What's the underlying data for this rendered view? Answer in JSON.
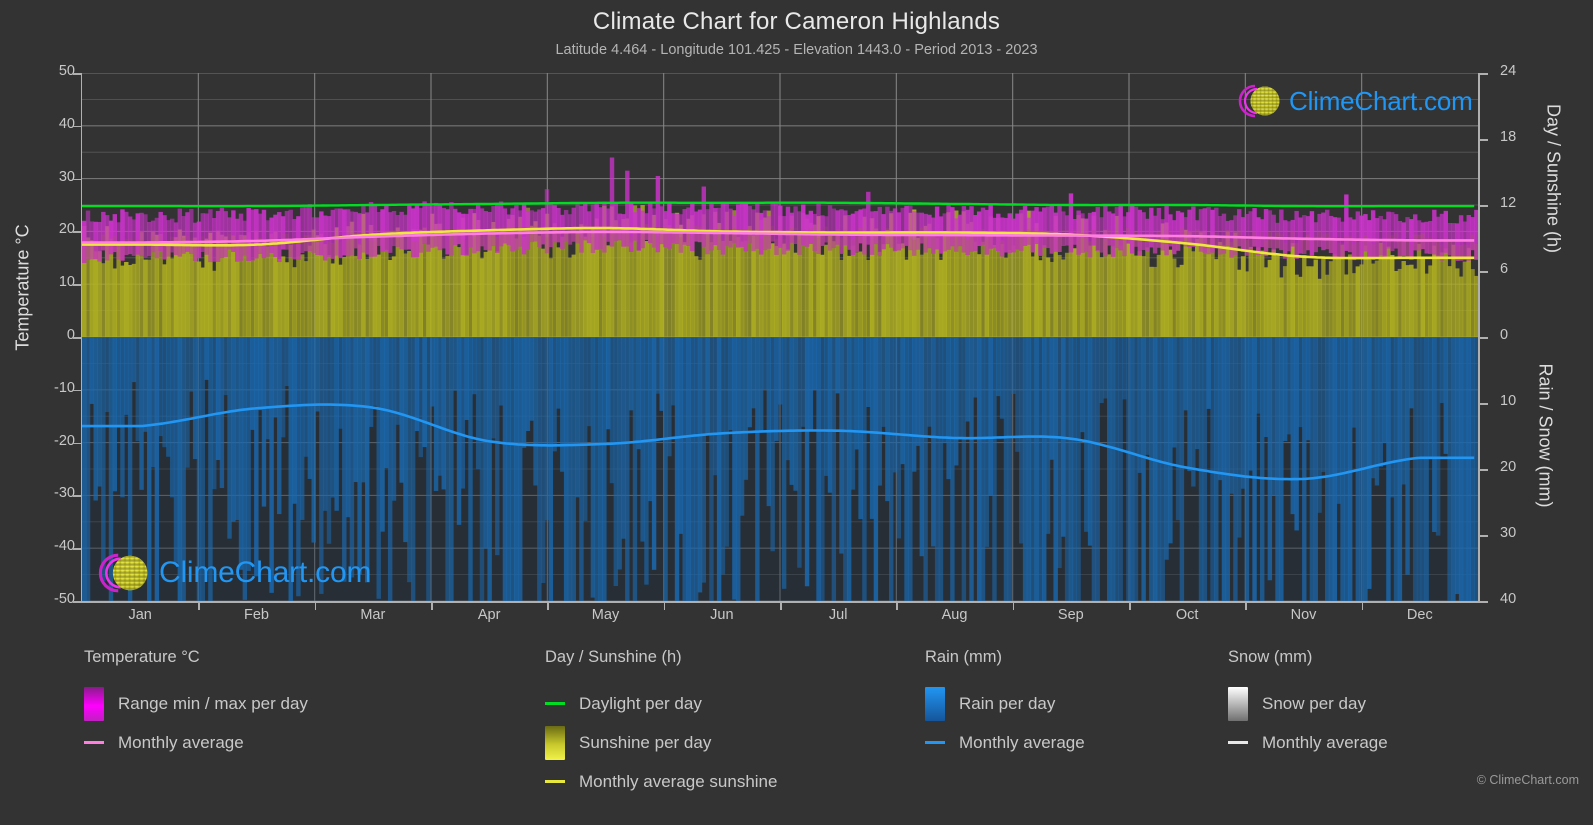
{
  "header": {
    "title": "Climate Chart for Cameron Highlands",
    "subtitle": "Latitude 4.464 - Longitude 101.425 - Elevation 1443.0 - Period 2013 - 2023"
  },
  "branding": {
    "logo_text": "ClimeChart.com",
    "copyright": "© ClimeChart.com"
  },
  "axes": {
    "left_label": "Temperature °C",
    "right_label_top": "Day / Sunshine (h)",
    "right_label_bottom": "Rain / Snow (mm)",
    "left_ticks": [
      "50",
      "40",
      "30",
      "20",
      "10",
      "0",
      "-10",
      "-20",
      "-30",
      "-40",
      "-50"
    ],
    "right_ticks_top": [
      "24",
      "18",
      "12",
      "6",
      "0"
    ],
    "right_ticks_bottom": [
      "10",
      "20",
      "30",
      "40"
    ]
  },
  "legend": {
    "groups": [
      {
        "title": "Temperature °C",
        "items": [
          {
            "label": "Range min / max per day",
            "style": "swatch",
            "color": "#ff00ff"
          },
          {
            "label": "Monthly average",
            "style": "line",
            "color": "#ff7fe0"
          }
        ]
      },
      {
        "title": "Day / Sunshine (h)",
        "items": [
          {
            "label": "Daylight per day",
            "style": "line",
            "color": "#00dd22"
          },
          {
            "label": "Sunshine per day",
            "style": "swatch",
            "color": "#e8e83c"
          },
          {
            "label": "Monthly average sunshine",
            "style": "line",
            "color": "#e8e83c"
          }
        ]
      },
      {
        "title": "Rain (mm)",
        "items": [
          {
            "label": "Rain per day",
            "style": "swatch",
            "color": "#1e88e5"
          },
          {
            "label": "Monthly average",
            "style": "line",
            "color": "#2196f3"
          }
        ]
      },
      {
        "title": "Snow (mm)",
        "items": [
          {
            "label": "Snow per day",
            "style": "swatch",
            "color": "#e0e0e0"
          },
          {
            "label": "Monthly average",
            "style": "line",
            "color": "#e8e8e8"
          }
        ]
      }
    ]
  },
  "chart_data": {
    "type": "area",
    "title": "Climate Chart for Cameron Highlands",
    "subtitle": "Latitude 4.464 - Longitude 101.425 - Elevation 1443.0 - Period 2013 - 2023",
    "xlabel": "",
    "ylabel": "Temperature °C",
    "ylim": [
      -50,
      50
    ],
    "y2lim_top": [
      0,
      24
    ],
    "y2lim_bottom": [
      0,
      40
    ],
    "grid": true,
    "legend_position": "below",
    "categories": [
      "Jan",
      "Feb",
      "Mar",
      "Apr",
      "May",
      "Jun",
      "Jul",
      "Aug",
      "Sep",
      "Oct",
      "Nov",
      "Dec"
    ],
    "series": [
      {
        "name": "Monthly average temperature",
        "unit": "°C",
        "color": "#ff7fe0",
        "values": [
          17.9,
          18.2,
          19.0,
          19.6,
          19.9,
          19.7,
          19.4,
          19.3,
          19.2,
          19.1,
          18.6,
          18.3
        ]
      },
      {
        "name": "Daily temperature range min",
        "unit": "°C",
        "color": "#b030c0",
        "values": [
          15.2,
          15.4,
          16.1,
          16.8,
          17.1,
          16.9,
          16.6,
          16.5,
          16.4,
          16.4,
          16.0,
          15.6
        ]
      },
      {
        "name": "Daily temperature range max",
        "unit": "°C",
        "color": "#ff00ff",
        "values": [
          22.8,
          23.4,
          24.2,
          24.3,
          24.5,
          24.2,
          23.9,
          23.8,
          23.7,
          23.4,
          22.9,
          22.7
        ]
      },
      {
        "name": "Daylight per day",
        "unit": "h",
        "color": "#00dd22",
        "values": [
          11.9,
          11.9,
          12.0,
          12.1,
          12.2,
          12.2,
          12.2,
          12.1,
          12.0,
          12.0,
          11.9,
          11.9
        ]
      },
      {
        "name": "Monthly average sunshine",
        "unit": "h",
        "color": "#e8e83c",
        "values": [
          8.4,
          8.4,
          9.3,
          9.7,
          9.9,
          9.6,
          9.5,
          9.5,
          9.3,
          8.5,
          7.3,
          7.2
        ]
      },
      {
        "name": "Rain monthly average",
        "unit": "mm",
        "color": "#2196f3",
        "values": [
          13.5,
          10.8,
          10.7,
          15.8,
          16.2,
          14.6,
          14.2,
          15.3,
          15.4,
          19.8,
          21.5,
          18.3
        ]
      },
      {
        "name": "Snow monthly average",
        "unit": "mm",
        "color": "#e8e8e8",
        "values": [
          0,
          0,
          0,
          0,
          0,
          0,
          0,
          0,
          0,
          0,
          0,
          0
        ]
      }
    ]
  }
}
